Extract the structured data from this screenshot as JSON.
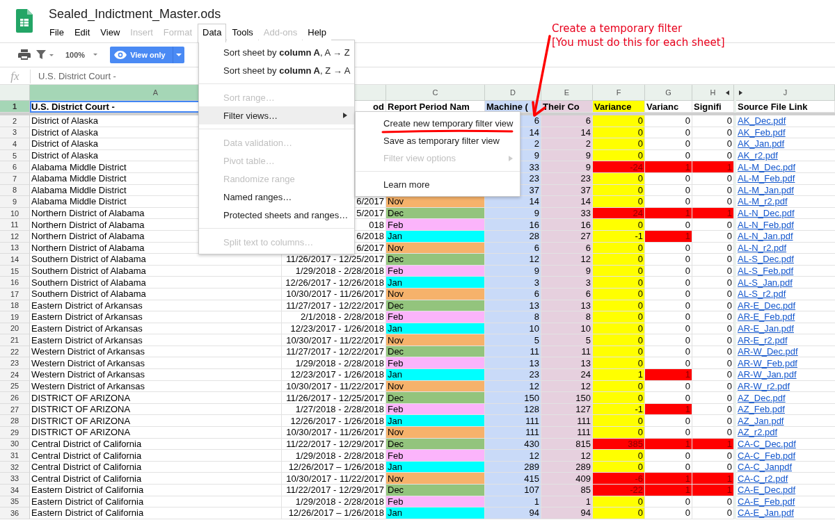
{
  "document": {
    "title": "Sealed_Indictment_Master.ods"
  },
  "menu": [
    {
      "label": "File",
      "disabled": false,
      "selected": false
    },
    {
      "label": "Edit",
      "disabled": false,
      "selected": false
    },
    {
      "label": "View",
      "disabled": false,
      "selected": false
    },
    {
      "label": "Insert",
      "disabled": true,
      "selected": false
    },
    {
      "label": "Format",
      "disabled": true,
      "selected": false
    },
    {
      "label": "Data",
      "disabled": false,
      "selected": true
    },
    {
      "label": "Tools",
      "disabled": false,
      "selected": false
    },
    {
      "label": "Add-ons",
      "disabled": true,
      "selected": false
    },
    {
      "label": "Help",
      "disabled": false,
      "selected": false
    }
  ],
  "toolbar": {
    "zoom": "100%",
    "mode_button": "View only"
  },
  "formula_bar": {
    "label": "fx",
    "value": "U.S. District Court -"
  },
  "columns": [
    {
      "letter": "A",
      "selected": true
    },
    {
      "letter": "C",
      "selected": false
    },
    {
      "letter": "D",
      "selected": false
    },
    {
      "letter": "E",
      "selected": false
    },
    {
      "letter": "F",
      "selected": false
    },
    {
      "letter": "G",
      "selected": false
    },
    {
      "letter": "H",
      "selected": false
    },
    {
      "letter": "J",
      "selected": false
    }
  ],
  "header_row": {
    "n": "1",
    "selected": true,
    "a": "U.S. District Court -",
    "b": "od",
    "c": "Report Period Nam",
    "d": "Machine (",
    "e": "Their Co",
    "f": "Variance",
    "g": "Varianc",
    "h": "Signifi",
    "j": "Source File Link"
  },
  "rows": [
    {
      "n": "2",
      "a": "District of Alaska",
      "d": "6",
      "e": "6",
      "f": "0",
      "f_flag": false,
      "g": "0",
      "g_flag": false,
      "h": "0",
      "h_flag": false,
      "j": "AK_Dec.pdf"
    },
    {
      "n": "3",
      "a": "District of Alaska",
      "d": "14",
      "e": "14",
      "f": "0",
      "f_flag": false,
      "g": "0",
      "g_flag": false,
      "h": "0",
      "h_flag": false,
      "j": "AK_Feb.pdf"
    },
    {
      "n": "4",
      "a": "District of Alaska",
      "d": "2",
      "e": "2",
      "f": "0",
      "f_flag": false,
      "g": "0",
      "g_flag": false,
      "h": "0",
      "h_flag": false,
      "j": "AK_Jan.pdf"
    },
    {
      "n": "5",
      "a": "District of Alaska",
      "d": "9",
      "e": "9",
      "f": "0",
      "f_flag": false,
      "g": "0",
      "g_flag": false,
      "h": "0",
      "h_flag": false,
      "j": "AK_r2.pdf"
    },
    {
      "n": "6",
      "a": "Alabama Middle District",
      "d": "33",
      "e": "9",
      "f": "-24",
      "f_flag": true,
      "g": "1",
      "g_flag": true,
      "h": "1",
      "h_flag": true,
      "j": "AL-M_Dec.pdf"
    },
    {
      "n": "7",
      "a": "Alabama Middle District",
      "d": "23",
      "e": "23",
      "f": "0",
      "f_flag": false,
      "g": "0",
      "g_flag": false,
      "h": "0",
      "h_flag": false,
      "j": "AL-M_Feb.pdf"
    },
    {
      "n": "8",
      "a": "Alabama Middle District",
      "d": "37",
      "e": "37",
      "f": "0",
      "f_flag": false,
      "g": "0",
      "g_flag": false,
      "h": "0",
      "h_flag": false,
      "j": "AL-M_Jan.pdf"
    },
    {
      "n": "9",
      "a": "Alabama Middle District",
      "b": "6/2017",
      "c": "Nov",
      "color": "#f6b26b",
      "d": "14",
      "e": "14",
      "f": "0",
      "f_flag": false,
      "g": "0",
      "g_flag": false,
      "h": "0",
      "h_flag": false,
      "j": "AL-M_r2.pdf"
    },
    {
      "n": "10",
      "a": "Northern District of Alabama",
      "b": "5/2017",
      "c": "Dec",
      "color": "#93c47d",
      "d": "9",
      "e": "33",
      "f": "24",
      "f_flag": true,
      "g": "1",
      "g_flag": true,
      "h": "1",
      "h_flag": true,
      "j": "AL-N_Dec.pdf"
    },
    {
      "n": "11",
      "a": "Northern District of Alabama",
      "b": "018",
      "c": "Feb",
      "color": "#fbb4fb",
      "d": "16",
      "e": "16",
      "f": "0",
      "f_flag": false,
      "g": "0",
      "g_flag": false,
      "h": "0",
      "h_flag": false,
      "j": "AL-N_Feb.pdf"
    },
    {
      "n": "12",
      "a": "Northern District of Alabama",
      "b": "6/2018",
      "c": "Jan",
      "color": "#00ffff",
      "d": "28",
      "e": "27",
      "f": "-1",
      "f_flag": false,
      "g": "1",
      "g_flag": true,
      "h": "0",
      "h_flag": false,
      "j": "AL-N_Jan.pdf"
    },
    {
      "n": "13",
      "a": "Northern District of Alabama",
      "b": "6/2017",
      "c": "Nov",
      "color": "#f6b26b",
      "d": "6",
      "e": "6",
      "f": "0",
      "f_flag": false,
      "g": "0",
      "g_flag": false,
      "h": "0",
      "h_flag": false,
      "j": "AL-N_r2.pdf"
    },
    {
      "n": "14",
      "a": "Southern District of Alabama",
      "b": "11/26/2017 - 12/25/2017",
      "c": "Dec",
      "color": "#93c47d",
      "d": "12",
      "e": "12",
      "f": "0",
      "f_flag": false,
      "g": "0",
      "g_flag": false,
      "h": "0",
      "h_flag": false,
      "j": "AL-S_Dec.pdf"
    },
    {
      "n": "15",
      "a": "Southern District of Alabama",
      "b": "1/29/2018 - 2/28/2018",
      "c": "Feb",
      "color": "#fbb4fb",
      "d": "9",
      "e": "9",
      "f": "0",
      "f_flag": false,
      "g": "0",
      "g_flag": false,
      "h": "0",
      "h_flag": false,
      "j": "AL-S_Feb.pdf"
    },
    {
      "n": "16",
      "a": "Southern District of Alabama",
      "b": "12/26/2017 - 12/26/2018",
      "c": "Jan",
      "color": "#00ffff",
      "d": "3",
      "e": "3",
      "f": "0",
      "f_flag": false,
      "g": "0",
      "g_flag": false,
      "h": "0",
      "h_flag": false,
      "j": "AL-S_Jan.pdf"
    },
    {
      "n": "17",
      "a": "Southern District of Alabama",
      "b": "10/30/2017 - 11/26/2017",
      "c": "Nov",
      "color": "#f6b26b",
      "d": "6",
      "e": "6",
      "f": "0",
      "f_flag": false,
      "g": "0",
      "g_flag": false,
      "h": "0",
      "h_flag": false,
      "j": "AL-S_r2.pdf"
    },
    {
      "n": "18",
      "a": "Eastern District of Arkansas",
      "b": "11/27/2017 - 12/22/2017",
      "c": "Dec",
      "color": "#93c47d",
      "d": "13",
      "e": "13",
      "f": "0",
      "f_flag": false,
      "g": "0",
      "g_flag": false,
      "h": "0",
      "h_flag": false,
      "j": "AR-E_Dec.pdf"
    },
    {
      "n": "19",
      "a": "Eastern District of Arkansas",
      "b": "2/1/2018 - 2/28/2018",
      "c": "Feb",
      "color": "#fbb4fb",
      "d": "8",
      "e": "8",
      "f": "0",
      "f_flag": false,
      "g": "0",
      "g_flag": false,
      "h": "0",
      "h_flag": false,
      "j": "AR-E_Feb.pdf"
    },
    {
      "n": "20",
      "a": "Eastern District of Arkansas",
      "b": "12/23/2017 - 1/26/2018",
      "c": "Jan",
      "color": "#00ffff",
      "d": "10",
      "e": "10",
      "f": "0",
      "f_flag": false,
      "g": "0",
      "g_flag": false,
      "h": "0",
      "h_flag": false,
      "j": "AR-E_Jan.pdf"
    },
    {
      "n": "21",
      "a": "Eastern District of Arkansas",
      "b": "10/30/2017 - 11/22/2017",
      "c": "Nov",
      "color": "#f6b26b",
      "d": "5",
      "e": "5",
      "f": "0",
      "f_flag": false,
      "g": "0",
      "g_flag": false,
      "h": "0",
      "h_flag": false,
      "j": "AR-E_r2.pdf"
    },
    {
      "n": "22",
      "a": "Western District of Arkansas",
      "b": "11/27/2017 - 12/22/2017",
      "c": "Dec",
      "color": "#93c47d",
      "d": "11",
      "e": "11",
      "f": "0",
      "f_flag": false,
      "g": "0",
      "g_flag": false,
      "h": "0",
      "h_flag": false,
      "j": "AR-W_Dec.pdf"
    },
    {
      "n": "23",
      "a": "Western District of Arkansas",
      "b": "1/29/2018 - 2/28/2018",
      "c": "Feb",
      "color": "#fbb4fb",
      "d": "13",
      "e": "13",
      "f": "0",
      "f_flag": false,
      "g": "0",
      "g_flag": false,
      "h": "0",
      "h_flag": false,
      "j": "AR-W_Feb.pdf"
    },
    {
      "n": "24",
      "a": "Western District of Arkansas",
      "b": "12/23/2017 - 1/26/2018",
      "c": "Jan",
      "color": "#00ffff",
      "d": "23",
      "e": "24",
      "f": "1",
      "f_flag": false,
      "g": "1",
      "g_flag": true,
      "h": "0",
      "h_flag": false,
      "j": "AR-W_Jan.pdf"
    },
    {
      "n": "25",
      "a": "Western District of Arkansas",
      "b": "10/30/2017 - 11/22/2017",
      "c": "Nov",
      "color": "#f6b26b",
      "d": "12",
      "e": "12",
      "f": "0",
      "f_flag": false,
      "g": "0",
      "g_flag": false,
      "h": "0",
      "h_flag": false,
      "j": "AR-W_r2.pdf"
    },
    {
      "n": "26",
      "a": "DISTRICT OF ARIZONA",
      "b": "11/26/2017 - 12/25/2017",
      "c": "Dec",
      "color": "#93c47d",
      "d": "150",
      "e": "150",
      "f": "0",
      "f_flag": false,
      "g": "0",
      "g_flag": false,
      "h": "0",
      "h_flag": false,
      "j": "AZ_Dec.pdf"
    },
    {
      "n": "27",
      "a": "DISTRICT OF ARIZONA",
      "b": "1/27/2018 - 2/28/2018",
      "c": "Feb",
      "color": "#fbb4fb",
      "d": "128",
      "e": "127",
      "f": "-1",
      "f_flag": false,
      "g": "1",
      "g_flag": true,
      "h": "0",
      "h_flag": false,
      "j": "AZ_Feb.pdf"
    },
    {
      "n": "28",
      "a": "DISTRICT OF ARIZONA",
      "b": "12/26/2017 - 1/26/2018",
      "c": "Jan",
      "color": "#00ffff",
      "d": "111",
      "e": "111",
      "f": "0",
      "f_flag": false,
      "g": "0",
      "g_flag": false,
      "h": "0",
      "h_flag": false,
      "j": "AZ_Jan.pdf"
    },
    {
      "n": "29",
      "a": "DISTRICT OF ARIZONA",
      "b": "10/30/2017 - 11/26/2017",
      "c": "Nov",
      "color": "#f6b26b",
      "d": "111",
      "e": "111",
      "f": "0",
      "f_flag": false,
      "g": "0",
      "g_flag": false,
      "h": "0",
      "h_flag": false,
      "j": "AZ_r2.pdf"
    },
    {
      "n": "30",
      "a": "Central District of California",
      "b": "11/22/2017 - 12/29/2017",
      "c": "Dec",
      "color": "#93c47d",
      "d": "430",
      "e": "815",
      "f": "385",
      "f_flag": true,
      "g": "1",
      "g_flag": true,
      "h": "1",
      "h_flag": true,
      "j": "CA-C_Dec.pdf"
    },
    {
      "n": "31",
      "a": "Central District of California",
      "b": "1/29/2018 - 2/28/2018",
      "c": "Feb",
      "color": "#fbb4fb",
      "d": "12",
      "e": "12",
      "f": "0",
      "f_flag": false,
      "g": "0",
      "g_flag": false,
      "h": "0",
      "h_flag": false,
      "j": "CA-C_Feb.pdf"
    },
    {
      "n": "32",
      "a": "Central District of California",
      "b": "12/26/2017 – 1/26/2018",
      "c": "Jan",
      "color": "#00ffff",
      "d": "289",
      "e": "289",
      "f": "0",
      "f_flag": false,
      "g": "0",
      "g_flag": false,
      "h": "0",
      "h_flag": false,
      "j": "CA-C_Janpdf"
    },
    {
      "n": "33",
      "a": "Central District of California",
      "b": "10/30/2017 - 11/22/2017",
      "c": "Nov",
      "color": "#f6b26b",
      "d": "415",
      "e": "409",
      "f": "-6",
      "f_flag": true,
      "g": "1",
      "g_flag": true,
      "h": "1",
      "h_flag": true,
      "j": "CA-C_r2.pdf"
    },
    {
      "n": "34",
      "a": "Eastern District of California",
      "b": "11/22/2017 - 12/29/2017",
      "c": "Dec",
      "color": "#93c47d",
      "d": "107",
      "e": "85",
      "f": "-22",
      "f_flag": true,
      "g": "1",
      "g_flag": true,
      "h": "1",
      "h_flag": true,
      "j": "CA-E_Dec.pdf"
    },
    {
      "n": "35",
      "a": "Eastern District of California",
      "b": "1/29/2018 - 2/28/2018",
      "c": "Feb",
      "color": "#fbb4fb",
      "d": "1",
      "e": "1",
      "f": "0",
      "f_flag": false,
      "g": "0",
      "g_flag": false,
      "h": "0",
      "h_flag": false,
      "j": "CA-E_Feb.pdf"
    },
    {
      "n": "36",
      "a": "Eastern District of California",
      "b": "12/26/2017 – 1/26/2018",
      "c": "Jan",
      "color": "#00ffff",
      "d": "94",
      "e": "94",
      "f": "0",
      "f_flag": false,
      "g": "0",
      "g_flag": false,
      "h": "0",
      "h_flag": false,
      "j": "CA-E_Jan.pdf"
    }
  ],
  "data_menu": [
    {
      "kind": "item",
      "label": "Sort sheet by **column A**, A → Z",
      "disabled": false,
      "selected": false,
      "submenu": false
    },
    {
      "kind": "item",
      "label": "Sort sheet by **column A**, Z → A",
      "disabled": false,
      "selected": false,
      "submenu": false
    },
    {
      "kind": "separator"
    },
    {
      "kind": "item",
      "label": "Sort range…",
      "disabled": true,
      "selected": false,
      "submenu": false
    },
    {
      "kind": "item",
      "label": "Filter views…",
      "disabled": false,
      "selected": true,
      "submenu": true
    },
    {
      "kind": "separator"
    },
    {
      "kind": "item",
      "label": "Data validation…",
      "disabled": true,
      "selected": false,
      "submenu": false
    },
    {
      "kind": "item",
      "label": "Pivot table…",
      "disabled": true,
      "selected": false,
      "submenu": false
    },
    {
      "kind": "item",
      "label": "Randomize range",
      "disabled": true,
      "selected": false,
      "submenu": false
    },
    {
      "kind": "item",
      "label": "Named ranges…",
      "disabled": false,
      "selected": false,
      "submenu": false
    },
    {
      "kind": "item",
      "label": "Protected sheets and ranges…",
      "disabled": false,
      "selected": false,
      "submenu": false
    },
    {
      "kind": "separator"
    },
    {
      "kind": "item",
      "label": "Split text to columns…",
      "disabled": true,
      "selected": false,
      "submenu": false
    }
  ],
  "filter_submenu": [
    {
      "kind": "item",
      "label": "Create new temporary filter view",
      "disabled": false,
      "submenu": false
    },
    {
      "kind": "item",
      "label": "Save as temporary filter view",
      "disabled": false,
      "submenu": false
    },
    {
      "kind": "item",
      "label": "Filter view options",
      "disabled": true,
      "submenu": true
    },
    {
      "kind": "separator"
    },
    {
      "kind": "item",
      "label": "Learn more",
      "disabled": false,
      "submenu": false
    }
  ],
  "annotation": {
    "lines": [
      "Create a temporary filter",
      "[You must do this for each sheet]"
    ]
  }
}
